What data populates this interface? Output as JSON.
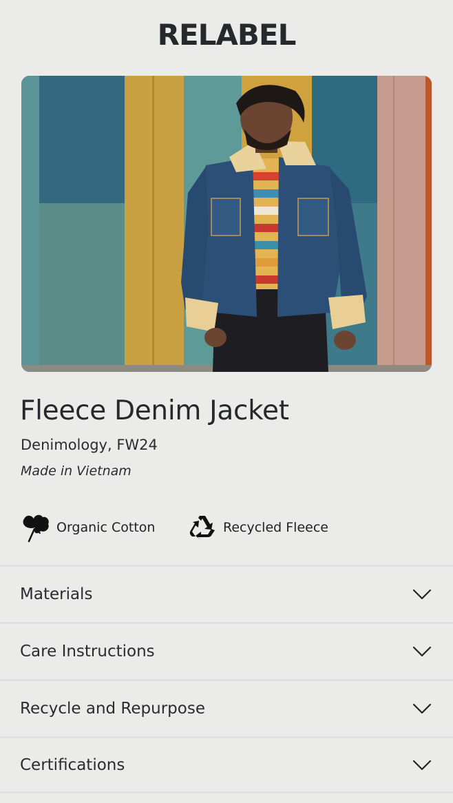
{
  "header": {
    "brand": "RELABEL"
  },
  "hero": {
    "image": "model-wearing-fleece-denim-jacket"
  },
  "product": {
    "name": "Fleece Denim Jacket",
    "brand_season": "Denimology, FW24",
    "origin": "Made in Vietnam"
  },
  "badges": [
    {
      "icon": "cotton-icon",
      "label": "Organic Cotton"
    },
    {
      "icon": "recycle-icon",
      "label": "Recycled Fleece"
    }
  ],
  "accordion": [
    {
      "label": "Materials"
    },
    {
      "label": "Care Instructions"
    },
    {
      "label": "Recycle and Repurpose"
    },
    {
      "label": "Certifications"
    }
  ]
}
